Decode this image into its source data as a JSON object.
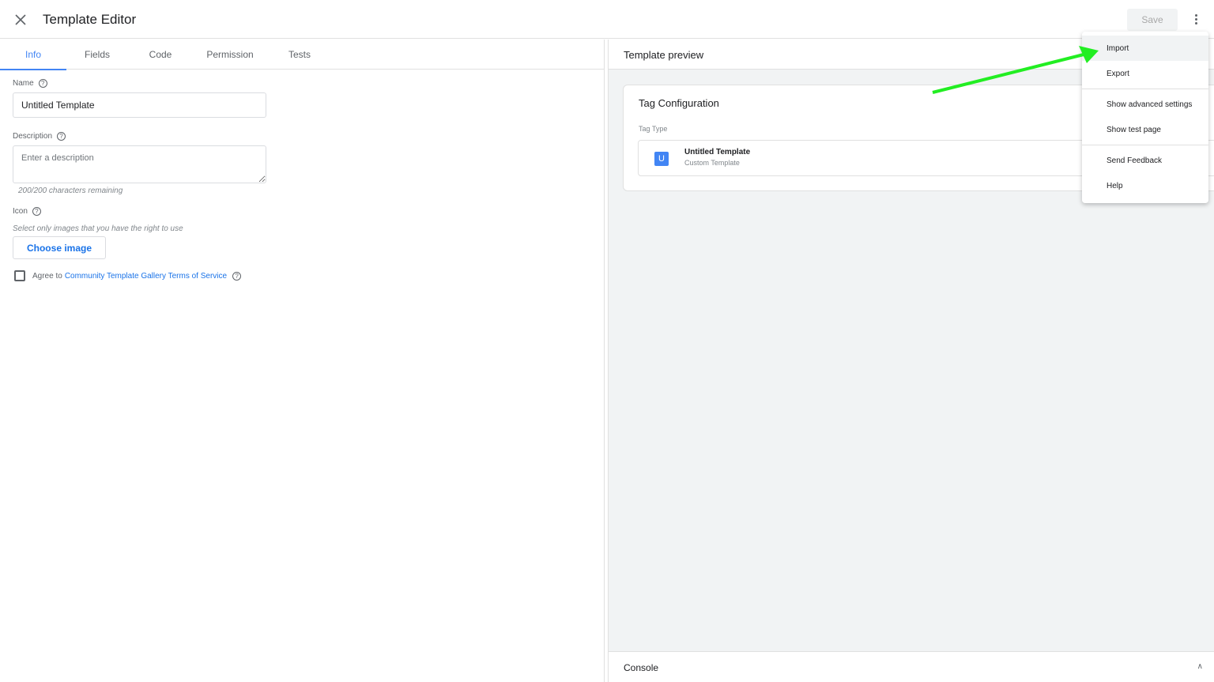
{
  "header": {
    "title": "Template Editor",
    "save_label": "Save"
  },
  "tabs": [
    {
      "label": "Info",
      "active": true
    },
    {
      "label": "Fields"
    },
    {
      "label": "Code"
    },
    {
      "label": "Permission"
    },
    {
      "label": "Tests"
    }
  ],
  "info": {
    "name_label": "Name",
    "name_value": "Untitled Template",
    "description_label": "Description",
    "description_placeholder": "Enter a description",
    "description_value": "",
    "chars_remaining": "200/200 characters remaining",
    "icon_label": "Icon",
    "icon_hint": "Select only images that you have the right to use",
    "choose_image_label": "Choose image",
    "agree_prefix": "Agree to",
    "agree_link": "Community Template Gallery Terms of Service",
    "agree_checked": false
  },
  "preview": {
    "title": "Template preview",
    "card_title": "Tag Configuration",
    "tag_type_label": "Tag Type",
    "tag_icon_letter": "U",
    "tag_name": "Untitled Template",
    "tag_desc": "Custom Template",
    "console_label": "Console"
  },
  "menu": {
    "items": [
      {
        "label": "Import"
      },
      {
        "label": "Export"
      },
      {
        "label": "Show advanced settings"
      },
      {
        "label": "Show test page"
      },
      {
        "label": "Send Feedback"
      },
      {
        "label": "Help"
      }
    ]
  },
  "colors": {
    "accent": "#4285f4",
    "link": "#1a73e8",
    "annotation_arrow": "#22ee22"
  }
}
